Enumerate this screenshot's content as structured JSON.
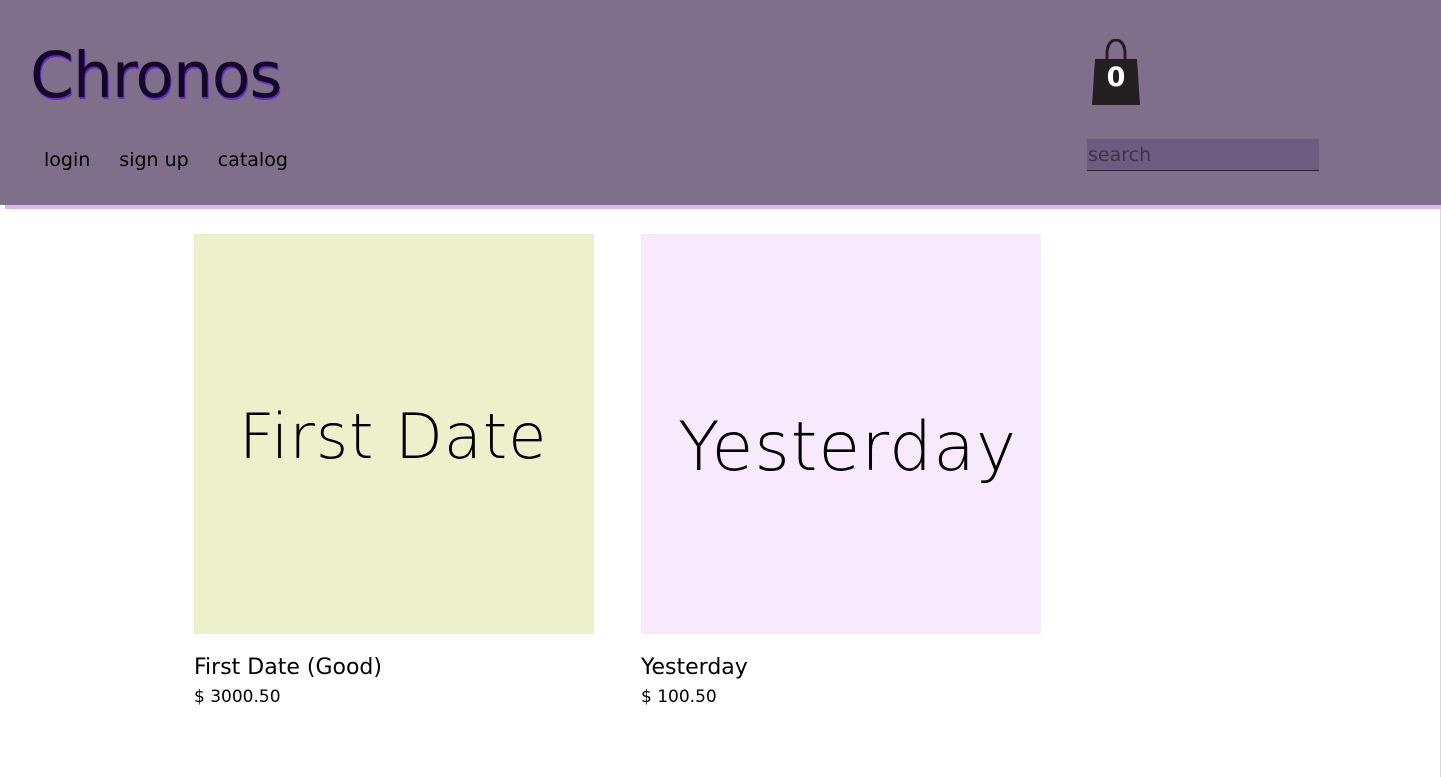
{
  "header": {
    "brand": "Chronos",
    "nav": [
      {
        "label": "login"
      },
      {
        "label": "sign up"
      },
      {
        "label": "catalog"
      }
    ],
    "cart_count": "0",
    "search_placeholder": "search"
  },
  "colors": {
    "header_bg": "#7f6f8a",
    "header_rule": "#dcb8e0",
    "search_bg": "#6d5c80",
    "cart_icon": "#231f20"
  },
  "products": [
    {
      "image_text": "First Date",
      "image_bg": "#edf0cb",
      "name": "First Date (Good)",
      "price": "$ 3000.50"
    },
    {
      "image_text": "Yesterday",
      "image_bg": "#f8e9fd",
      "name": "Yesterday",
      "price": "$ 100.50"
    }
  ],
  "icons": {
    "cart": "shopping-bag-icon"
  }
}
